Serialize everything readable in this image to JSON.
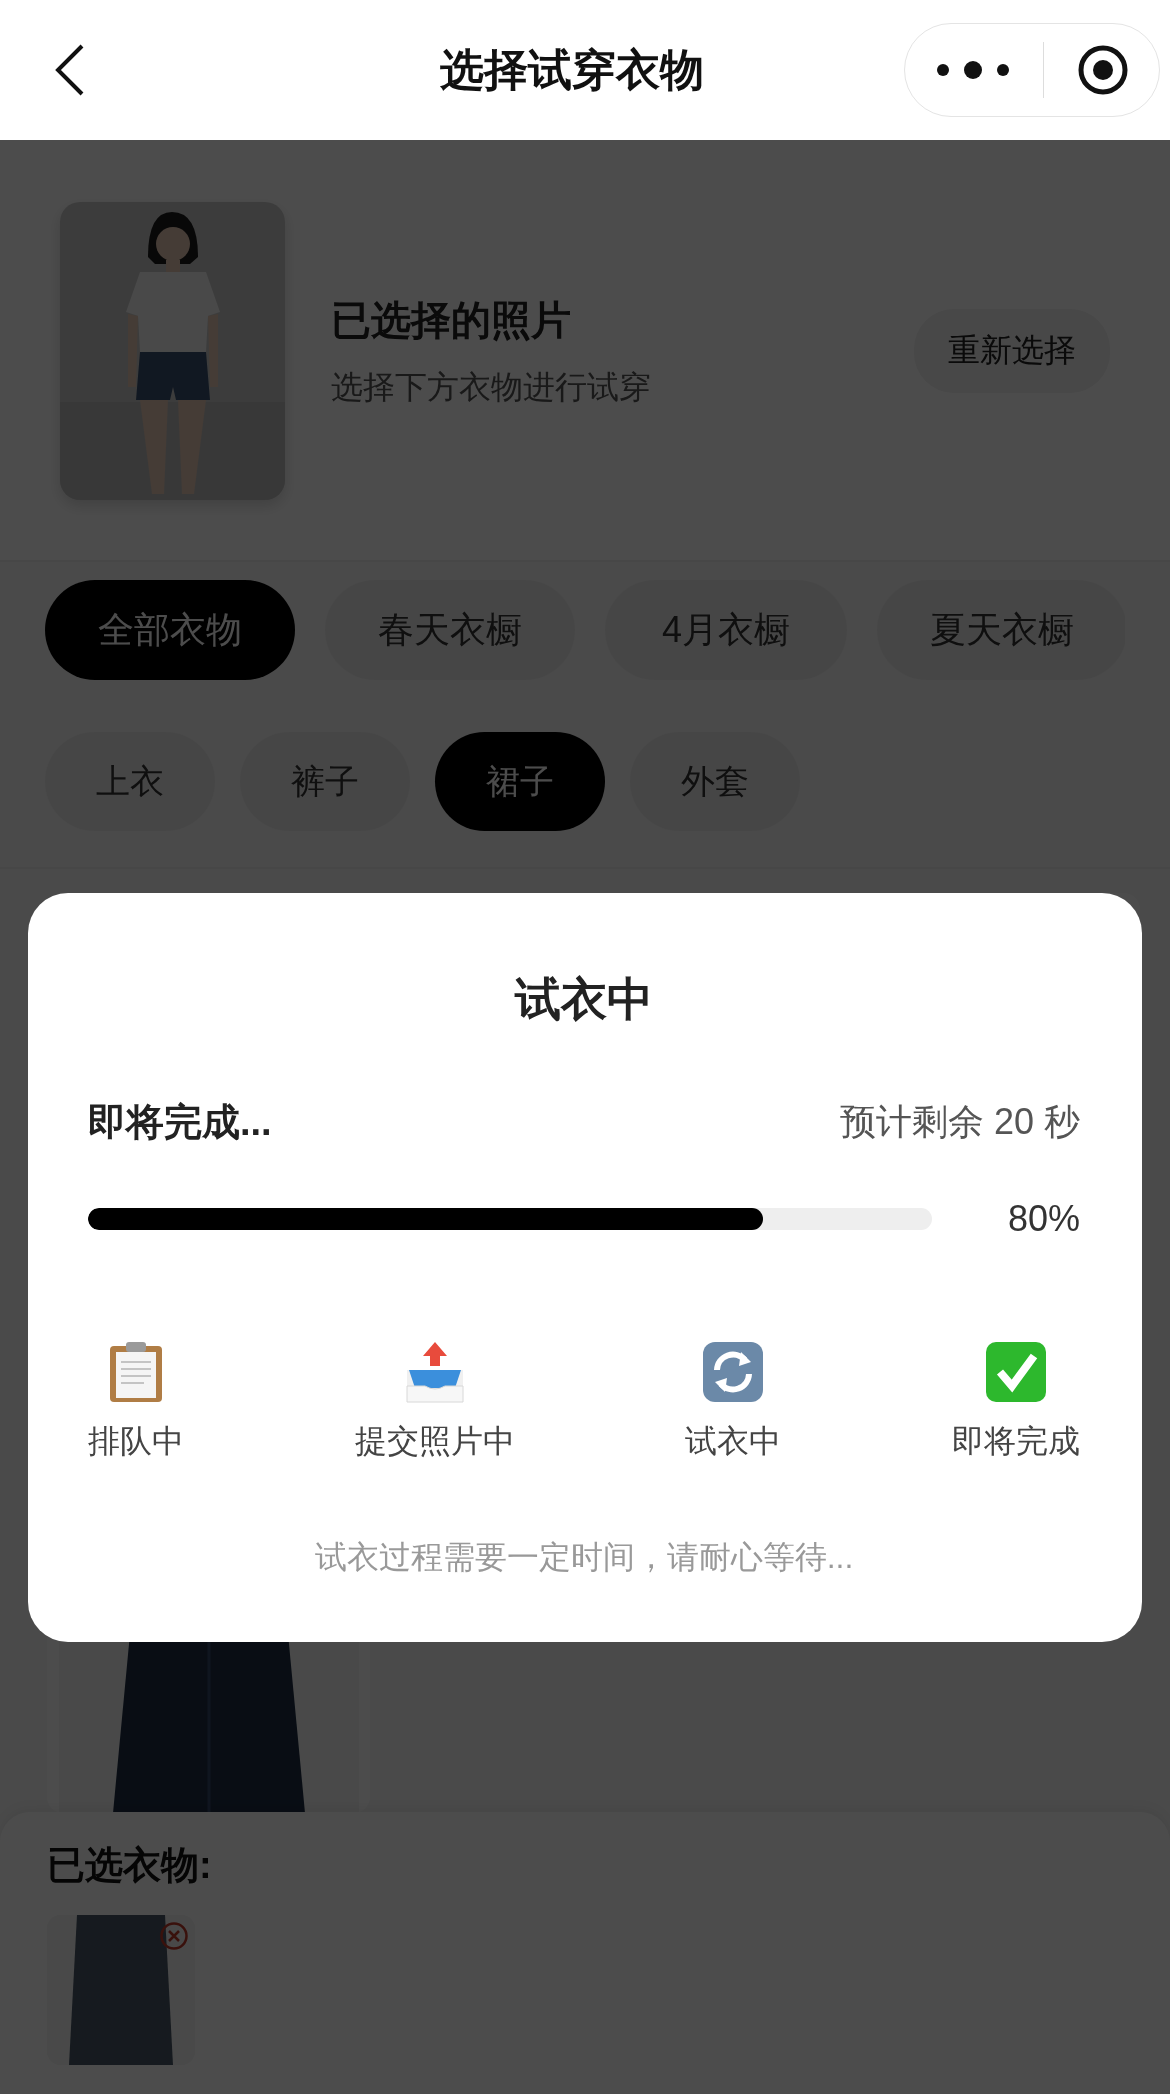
{
  "nav": {
    "title": "选择试穿衣物"
  },
  "photo_section": {
    "title": "已选择的照片",
    "subtitle": "选择下方衣物进行试穿",
    "reselect_button": "重新选择"
  },
  "wardrobes": [
    {
      "label": "全部衣物",
      "selected": true
    },
    {
      "label": "春天衣橱",
      "selected": false
    },
    {
      "label": "4月衣橱",
      "selected": false
    },
    {
      "label": "夏天衣橱",
      "selected": false
    }
  ],
  "categories": [
    {
      "label": "上衣",
      "selected": false
    },
    {
      "label": "裤子",
      "selected": false
    },
    {
      "label": "裙子",
      "selected": true
    },
    {
      "label": "外套",
      "selected": false
    }
  ],
  "selected_panel": {
    "title": "已选衣物:"
  },
  "modal": {
    "title": "试衣中",
    "status": "即将完成...",
    "remaining": "预计剩余 20 秒",
    "progress": {
      "level": 0.8,
      "reading": "80%"
    },
    "steps": [
      {
        "kind": "clipboard",
        "label": "排队中"
      },
      {
        "kind": "outbox",
        "label": "提交照片中"
      },
      {
        "kind": "refresh",
        "label": "试衣中"
      },
      {
        "kind": "check",
        "label": "即将完成"
      }
    ],
    "note": "试衣过程需要一定时间，请耐心等待..."
  }
}
